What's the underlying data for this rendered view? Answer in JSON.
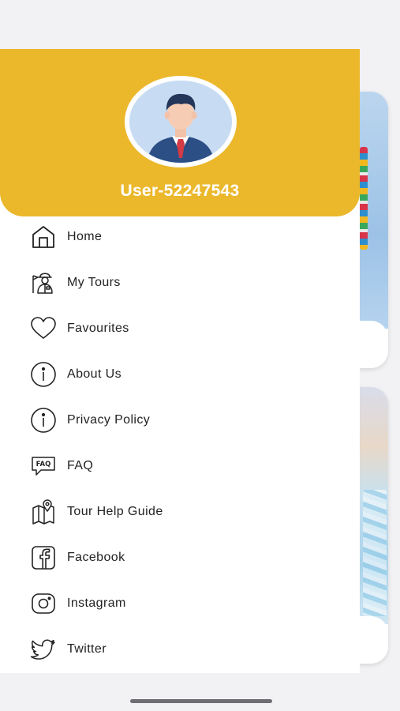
{
  "profile": {
    "username": "User-52247543"
  },
  "menu": {
    "items": [
      {
        "label": "Home",
        "icon": "home-icon"
      },
      {
        "label": "My Tours",
        "icon": "tour-guide-icon"
      },
      {
        "label": "Favourites",
        "icon": "heart-icon"
      },
      {
        "label": "About Us",
        "icon": "info-icon"
      },
      {
        "label": "Privacy Policy",
        "icon": "info-icon"
      },
      {
        "label": "FAQ",
        "icon": "faq-icon"
      },
      {
        "label": "Tour Help Guide",
        "icon": "map-pin-icon"
      },
      {
        "label": "Facebook",
        "icon": "facebook-icon"
      },
      {
        "label": "Instagram",
        "icon": "instagram-icon"
      },
      {
        "label": "Twitter",
        "icon": "twitter-icon"
      }
    ]
  },
  "colors": {
    "header": "#ebb82c",
    "text": "#222222",
    "background": "#ffffff"
  }
}
